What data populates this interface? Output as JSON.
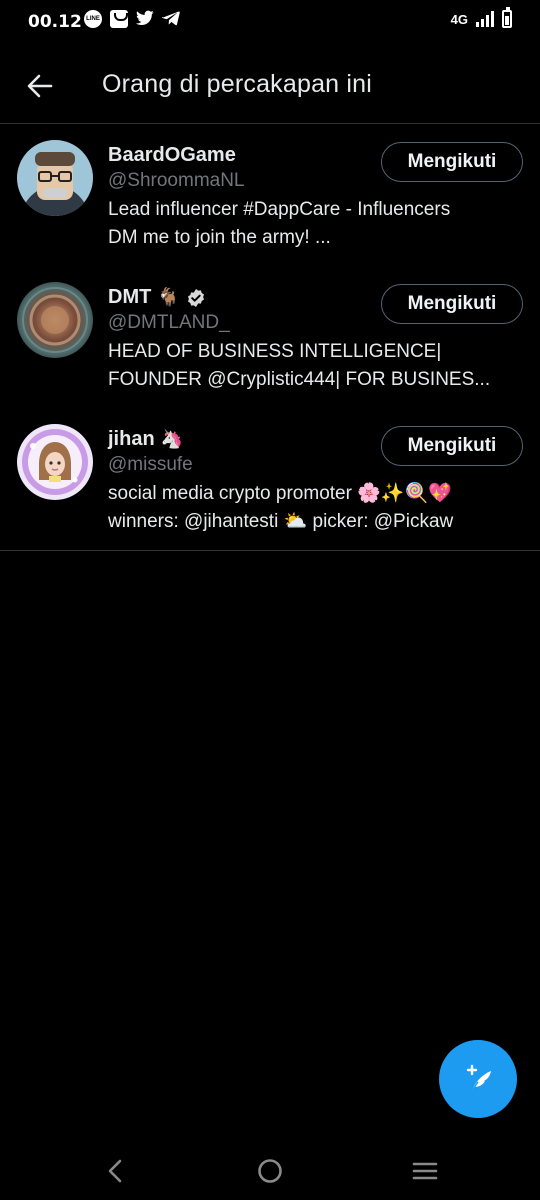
{
  "status_bar": {
    "time": "00.12",
    "network": "4G",
    "icons": [
      "line-icon",
      "mail-icon",
      "twitter-icon",
      "telegram-icon",
      "signal-icon",
      "battery-icon"
    ]
  },
  "header": {
    "title": "Orang di percakapan ini",
    "back_icon": "arrow-left-icon"
  },
  "users": [
    {
      "name": "BaardOGame",
      "name_emoji": "",
      "verified": false,
      "handle": "@ShroommaNL",
      "bio_lines": [
        "Lead influencer #DappCare - Influencers",
        "DM me to join the army! ..."
      ],
      "follow_label": "Mengikuti"
    },
    {
      "name": "DMT",
      "name_emoji": "🐐",
      "verified": true,
      "handle": "@DMTLAND_",
      "bio_lines": [
        "HEAD OF BUSINESS INTELLIGENCE|",
        "FOUNDER @Cryplistic444| FOR BUSINES..."
      ],
      "follow_label": "Mengikuti"
    },
    {
      "name": "jihan",
      "name_emoji": "🦄",
      "verified": false,
      "handle": "@missufe",
      "bio_lines": [
        "social media crypto promoter 🌸✨🍭💖",
        "winners: @jihantesti ⛅ picker: @Pickaw"
      ],
      "follow_label": "Mengikuti"
    }
  ],
  "fab": {
    "icon": "compose-tweet-icon"
  },
  "nav": {
    "icons": [
      "nav-back-icon",
      "nav-home-icon",
      "nav-menu-icon"
    ]
  },
  "colors": {
    "background": "#000000",
    "accent": "#1d9bf0",
    "text": "#e7e9ea",
    "muted": "#71767b",
    "divider": "#2f3336"
  }
}
